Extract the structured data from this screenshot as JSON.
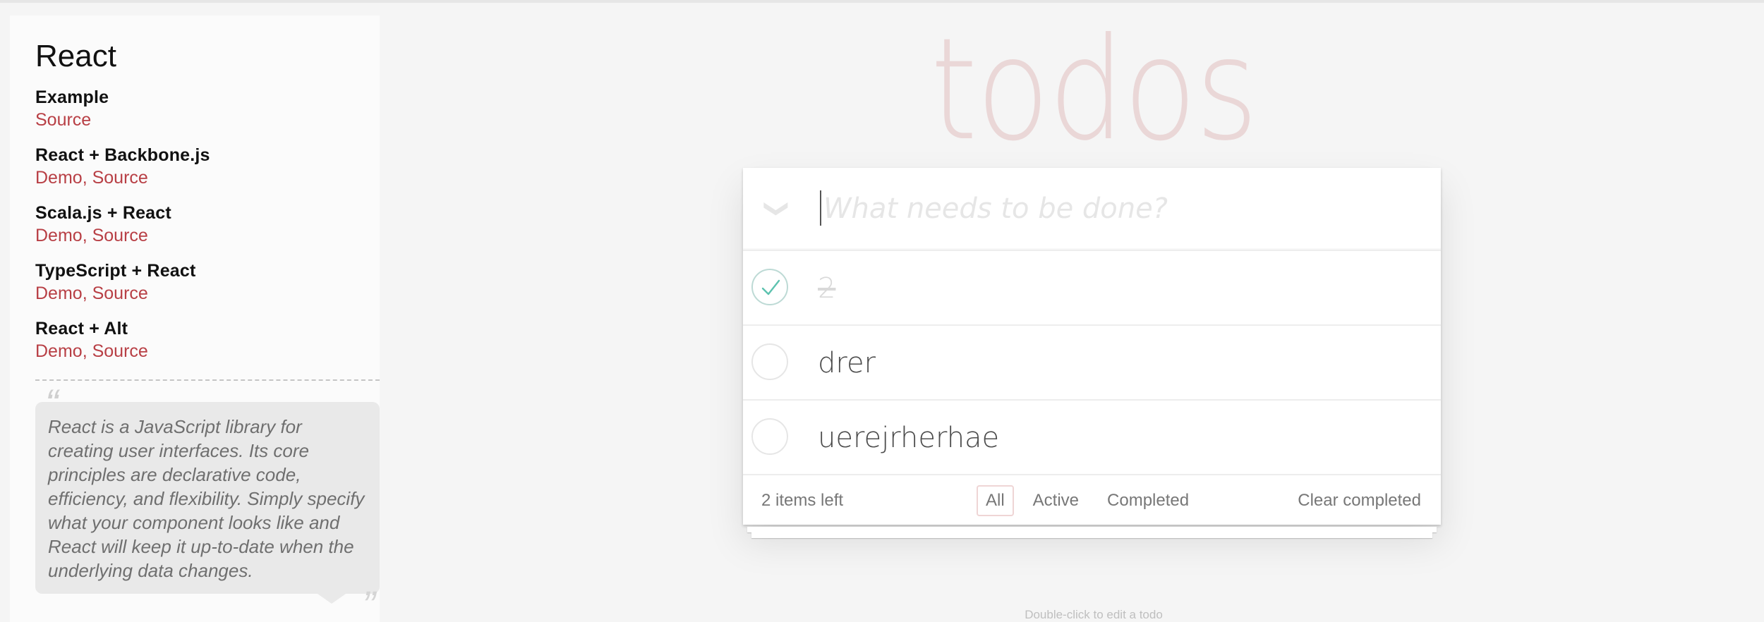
{
  "sidebar": {
    "title": "React",
    "examples": [
      {
        "name": "Example",
        "links": [
          "Source"
        ]
      },
      {
        "name": "React + Backbone.js",
        "links": [
          "Demo",
          "Source"
        ]
      },
      {
        "name": "Scala.js + React",
        "links": [
          "Demo",
          "Source"
        ]
      },
      {
        "name": "TypeScript + React",
        "links": [
          "Demo",
          "Source"
        ]
      },
      {
        "name": "React + Alt",
        "links": [
          "Demo",
          "Source"
        ]
      }
    ],
    "quote": "React is a JavaScript library for creating user interfaces. Its core principles are declarative code, efficiency, and flexibility. Simply specify what your component looks like and React will keep it up-to-date when the underlying data changes.",
    "quote_open": "“",
    "quote_close": "”"
  },
  "app": {
    "title": "todos",
    "toggle_all_glyph": "❯",
    "new_todo_placeholder": "What needs to be done?",
    "todos": [
      {
        "label": "2",
        "completed": true
      },
      {
        "label": "drer",
        "completed": false
      },
      {
        "label": "uerejrherhae",
        "completed": false
      }
    ],
    "footer": {
      "count": "2 items left",
      "filters": [
        "All",
        "Active",
        "Completed"
      ],
      "selected_filter": "All",
      "clear": "Clear completed"
    },
    "info": "Double-click to edit a todo"
  },
  "colors": {
    "link": "#b83f45",
    "title": "rgba(175,47,47,0.15)",
    "check": "#5dc2af"
  }
}
